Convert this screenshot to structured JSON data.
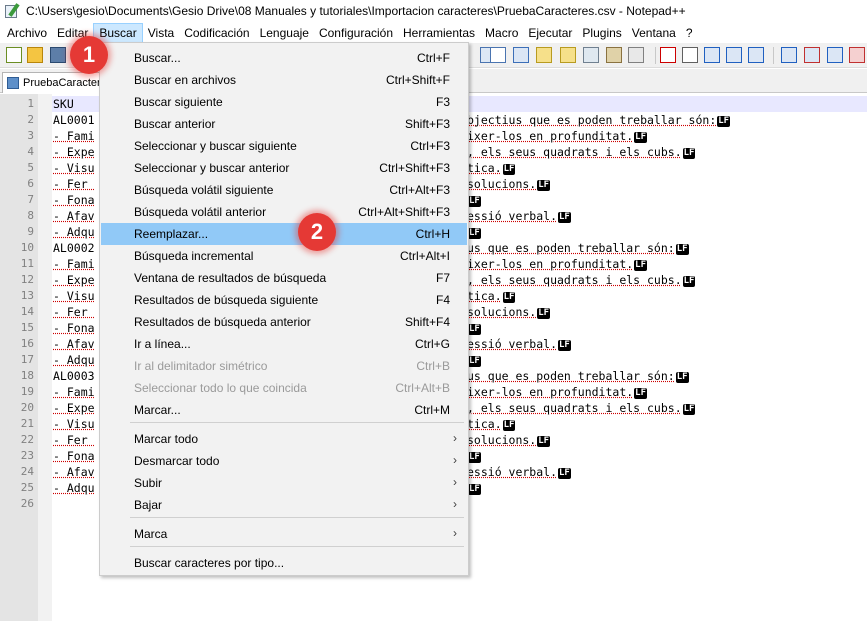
{
  "window": {
    "title": "C:\\Users\\gesio\\Documents\\Gesio Drive\\08 Manuales y tutoriales\\Importacion caracteres\\PruebaCaracteres.csv - Notepad++"
  },
  "menubar": [
    "Archivo",
    "Editar",
    "Buscar",
    "Vista",
    "Codificación",
    "Lenguaje",
    "Configuración",
    "Herramientas",
    "Macro",
    "Ejecutar",
    "Plugins",
    "Ventana",
    "?"
  ],
  "menubar_active": "Buscar",
  "tab": {
    "label": "PruebaCaracteres"
  },
  "line_numbers": [
    "1",
    "2",
    "3",
    "4",
    "5",
    "6",
    "7",
    "8",
    "9",
    "10",
    "11",
    "12",
    "13",
    "14",
    "15",
    "16",
    "17",
    "18",
    "19",
    "20",
    "21",
    "22",
    "23",
    "24",
    "25",
    "26"
  ],
  "editor_left": [
    "SKU",
    "AL0001",
    "- Fami",
    "- Expe",
    "- Visu",
    "- Fer ",
    "- Fona",
    "- Afav",
    "- Adqu",
    "AL0002",
    "- Fami",
    "- Expe",
    "- Visu",
    "- Fer ",
    "- Fona",
    "- Afav",
    "- Adqu",
    "AL0003",
    "- Fami",
    "- Expe",
    "- Visu",
    "- Fer ",
    "- Fona",
    "- Afav",
    "- Adqu",
    ""
  ],
  "editor_right": [
    "",
    "bjectius que es poden treballar són:",
    "ixer-los en profunditat.",
    ", els seus quadrats i els cubs.",
    "tica.",
    "solucions.",
    "",
    "essió verbal.",
    "",
    "us que es poden treballar són:",
    "ixer-los en profunditat.",
    ", els seus quadrats i els cubs.",
    "tica.",
    "solucions.",
    "",
    "essió verbal.",
    "",
    "us que es poden treballar són:",
    "ixer-los en profunditat.",
    ", els seus quadrats i els cubs.",
    "tica.",
    "solucions.",
    "",
    "essió verbal.",
    "",
    ""
  ],
  "eol_marker": "LF",
  "dropdown": {
    "items": [
      {
        "label": "Buscar...",
        "shortcut": "Ctrl+F"
      },
      {
        "label": "Buscar en archivos",
        "shortcut": "Ctrl+Shift+F"
      },
      {
        "label": "Buscar siguiente",
        "shortcut": "F3"
      },
      {
        "label": "Buscar anterior",
        "shortcut": "Shift+F3"
      },
      {
        "label": "Seleccionar y buscar siguiente",
        "shortcut": "Ctrl+F3"
      },
      {
        "label": "Seleccionar y buscar anterior",
        "shortcut": "Ctrl+Shift+F3"
      },
      {
        "label": "Búsqueda volátil siguiente",
        "shortcut": "Ctrl+Alt+F3"
      },
      {
        "label": "Búsqueda volátil anterior",
        "shortcut": "Ctrl+Alt+Shift+F3"
      },
      {
        "label": "Reemplazar...",
        "shortcut": "Ctrl+H"
      },
      {
        "label": "Búsqueda incremental",
        "shortcut": "Ctrl+Alt+I"
      },
      {
        "label": "Ventana de resultados de búsqueda",
        "shortcut": "F7"
      },
      {
        "label": "Resultados de búsqueda siguiente",
        "shortcut": "F4"
      },
      {
        "label": "Resultados de búsqueda anterior",
        "shortcut": "Shift+F4"
      },
      {
        "label": "Ir a línea...",
        "shortcut": "Ctrl+G"
      },
      {
        "label": "Ir al delimitador simétrico",
        "shortcut": "Ctrl+B"
      },
      {
        "label": "Seleccionar todo lo que coincida",
        "shortcut": "Ctrl+Alt+B"
      },
      {
        "label": "Marcar...",
        "shortcut": "Ctrl+M"
      },
      {
        "label": "Marcar todo",
        "shortcut": ""
      },
      {
        "label": "Desmarcar todo",
        "shortcut": ""
      },
      {
        "label": "Subir",
        "shortcut": ""
      },
      {
        "label": "Bajar",
        "shortcut": ""
      },
      {
        "label": "Marca",
        "shortcut": ""
      },
      {
        "label": "Buscar caracteres por tipo...",
        "shortcut": ""
      }
    ],
    "highlighted": "Reemplazar...",
    "disabled": [
      "Ir al delimitador simétrico",
      "Seleccionar todo lo que coincida"
    ],
    "submenu_arrow": "›"
  },
  "callouts": [
    {
      "label": "1"
    },
    {
      "label": "2"
    }
  ],
  "colors": {
    "callout": "#e53935",
    "menu_highlight": "#91c9f7",
    "menubar_active": "#cce8ff",
    "gutter": "#e4e4e4"
  }
}
